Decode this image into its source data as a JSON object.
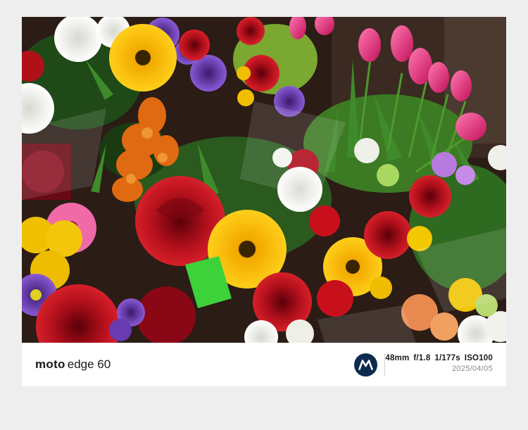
{
  "watermark": {
    "brand": "moto",
    "model": "edge 60",
    "exif": {
      "focal_length": "48mm",
      "aperture": "f/1.8",
      "shutter": "1/177s",
      "iso": "ISO100"
    },
    "date": "2025/04/05"
  },
  "photo": {
    "subject": "flower-market-bouquets",
    "colors": {
      "frame_background": "#eeeeee",
      "logo_background": "#0d2a4f"
    }
  }
}
